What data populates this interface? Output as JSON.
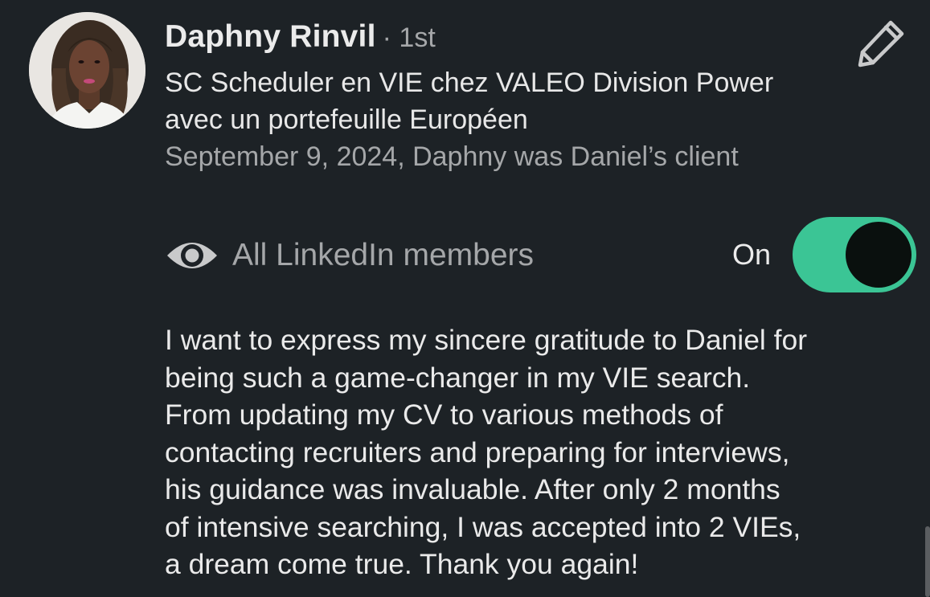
{
  "recommendation": {
    "author_name": "Daphny Rinvil",
    "connection_degree": "· 1st",
    "headline": "SC Scheduler en VIE chez VALEO Division Power avec un portefeuille Européen",
    "relation": "September 9, 2024, Daphny was Daniel’s client",
    "visibility": {
      "label": "All LinkedIn members",
      "toggle_state_label": "On",
      "is_on": true,
      "toggle_color": "#3bc595"
    },
    "body_lines": [
      "I want to express my sincere gratitude to Daniel for",
      "being such a game-changer in my VIE search.",
      "From updating my CV to various methods of",
      "contacting recruiters and preparing for interviews,",
      "his guidance was invaluable. After only 2 months",
      "of intensive searching, I was accepted into 2 VIEs,",
      "a dream come true. Thank you again!"
    ],
    "icons": {
      "edit": "pencil-icon",
      "visibility": "eye-icon"
    }
  }
}
